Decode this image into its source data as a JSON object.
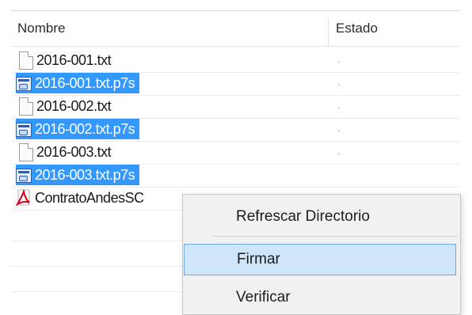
{
  "columns": {
    "name": "Nombre",
    "status": "Estado"
  },
  "files": [
    {
      "name": "2016-001.txt",
      "icon": "text-file-icon",
      "selected": false,
      "status": "."
    },
    {
      "name": "2016-001.txt.p7s",
      "icon": "certificate-file-icon",
      "selected": true,
      "status": "."
    },
    {
      "name": "2016-002.txt",
      "icon": "text-file-icon",
      "selected": false,
      "status": "."
    },
    {
      "name": "2016-002.txt.p7s",
      "icon": "certificate-file-icon",
      "selected": true,
      "status": "."
    },
    {
      "name": "2016-003.txt",
      "icon": "text-file-icon",
      "selected": false,
      "status": "."
    },
    {
      "name": "2016-003.txt.p7s",
      "icon": "certificate-file-icon",
      "selected": true,
      "status": ""
    },
    {
      "name": "ContratoAndesSC",
      "icon": "pdf-file-icon",
      "selected": false,
      "status": ""
    }
  ],
  "context_menu": {
    "refresh": "Refrescar Directorio",
    "sign": "Firmar",
    "verify": "Verificar"
  },
  "colors": {
    "selection": "#3399ff",
    "menu_highlight": "#cfe5f9",
    "menu_highlight_border": "#6ea8e0"
  }
}
